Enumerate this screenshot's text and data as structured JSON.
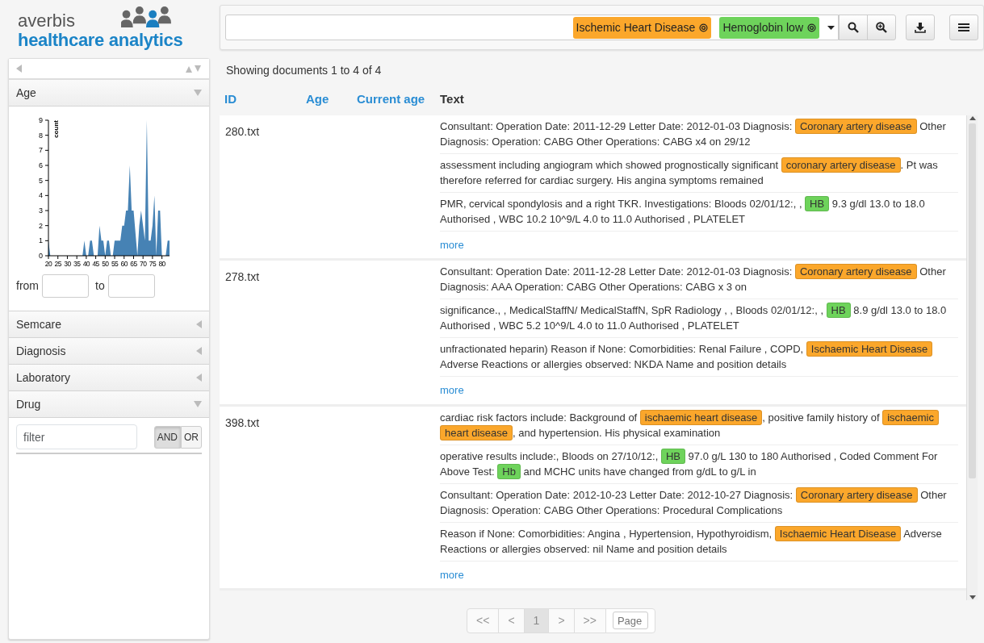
{
  "logo": {
    "line1": "averbis",
    "line2": "healthcare analytics"
  },
  "sidebar": {
    "facets": [
      {
        "title": "Age",
        "expanded": true,
        "kind": "histogram",
        "from_label": "from",
        "to_label": "to",
        "chart_data": {
          "type": "area",
          "ylabel": "count",
          "x": [
            20,
            21,
            22,
            38,
            39,
            40,
            41,
            42,
            43,
            44,
            46,
            47,
            48,
            49,
            50,
            51,
            52,
            53,
            54,
            55,
            56,
            57,
            58,
            59,
            60,
            61,
            62,
            63,
            64,
            65,
            67,
            68,
            69,
            70,
            71,
            72,
            73,
            74,
            75,
            76,
            77,
            78,
            79,
            80,
            81,
            82,
            83,
            84
          ],
          "values": [
            1,
            0,
            0,
            0,
            1,
            0,
            0,
            1,
            1,
            0,
            0,
            2,
            1,
            1,
            0,
            1,
            1,
            0,
            0,
            1,
            1,
            1,
            1,
            2,
            2,
            3,
            3,
            6,
            3,
            3,
            0,
            2,
            3,
            2,
            1,
            9,
            1,
            1,
            2,
            4,
            0,
            3,
            3,
            0,
            0,
            0,
            1,
            1
          ],
          "xlim": [
            20,
            84
          ],
          "ylim": [
            0,
            9
          ],
          "xticks": [
            20,
            25,
            30,
            35,
            40,
            45,
            50,
            55,
            60,
            65,
            70,
            75,
            80
          ],
          "yticks": [
            0,
            1,
            2,
            3,
            4,
            5,
            6,
            7,
            8,
            9
          ]
        }
      },
      {
        "title": "Semcare",
        "expanded": false
      },
      {
        "title": "Diagnosis",
        "expanded": false
      },
      {
        "title": "Laboratory",
        "expanded": false
      },
      {
        "title": "Drug",
        "expanded": true,
        "kind": "filter",
        "filter": {
          "placeholder": "filter"
        },
        "modes": [
          {
            "label": "AND",
            "selected": true
          },
          {
            "label": "OR",
            "selected": false
          }
        ]
      }
    ]
  },
  "search": {
    "tokens": [
      {
        "label": "Ischemic Heart Disease",
        "color": "#fba72b"
      },
      {
        "label": "Hemoglobin low",
        "color": "#6ed35b"
      }
    ]
  },
  "summary": "Showing documents 1 to 4 of 4",
  "columns": [
    {
      "label": "ID",
      "sortable": true
    },
    {
      "label": "Age",
      "sortable": true
    },
    {
      "label": "Current age",
      "sortable": true
    },
    {
      "label": "Text",
      "sortable": false
    }
  ],
  "documents": [
    {
      "id": "280.txt",
      "more": "more",
      "snippets": [
        [
          {
            "text": "Consultant: Operation Date: 2011-12-29 Letter Date: 2012-01-03 Diagnosis: "
          },
          {
            "text": "Coronary artery disease",
            "color": "#fba72b"
          },
          {
            "text": " Other Diagnosis: Operation: CABG Other Operations: CABG x4 on 29/12"
          }
        ],
        [
          {
            "text": "assessment including angiogram which showed prognostically significant "
          },
          {
            "text": "coronary artery disease",
            "color": "#fba72b"
          },
          {
            "text": ". Pt was therefore referred for cardiac surgery. His angina symptoms remained"
          }
        ],
        [
          {
            "text": "PMR, cervical spondylosis and a right TKR. Investigations: Bloods 02/01/12:, , "
          },
          {
            "text": "HB",
            "color": "#6ed35b"
          },
          {
            "text": " 9.3 g/dl 13.0 to 18.0 Authorised , WBC 10.2 10^9/L 4.0 to 11.0 Authorised , PLATELET"
          }
        ]
      ]
    },
    {
      "id": "278.txt",
      "more": "more",
      "snippets": [
        [
          {
            "text": "Consultant: Operation Date: 2011-12-28 Letter Date: 2012-01-03 Diagnosis: "
          },
          {
            "text": "Coronary artery disease",
            "color": "#fba72b"
          },
          {
            "text": " Other Diagnosis: AAA Operation: CABG Other Operations: CABG x 3 on"
          }
        ],
        [
          {
            "text": "significance., , MedicalStaffN/ MedicalStaffN, SpR Radiology , , Bloods 02/01/12:, , "
          },
          {
            "text": "HB",
            "color": "#6ed35b"
          },
          {
            "text": " 8.9 g/dl 13.0 to 18.0 Authorised , WBC 5.2 10^9/L 4.0 to 11.0 Authorised , PLATELET"
          }
        ],
        [
          {
            "text": "unfractionated heparin) Reason if None: Comorbidities: Renal Failure , COPD, "
          },
          {
            "text": "Ischaemic Heart Disease",
            "color": "#fba72b"
          },
          {
            "text": " Adverse Reactions or allergies observed: NKDA Name and position details"
          }
        ]
      ]
    },
    {
      "id": "398.txt",
      "more": "more",
      "snippets": [
        [
          {
            "text": "cardiac risk factors include: Background of "
          },
          {
            "text": "ischaemic heart disease",
            "color": "#fba72b"
          },
          {
            "text": ", positive family history of "
          },
          {
            "text": "ischaemic heart disease",
            "color": "#fba72b"
          },
          {
            "text": ", and hypertension. His physical examination"
          }
        ],
        [
          {
            "text": "operative results include:, Bloods on 27/10/12:, "
          },
          {
            "text": "HB",
            "color": "#6ed35b"
          },
          {
            "text": " 97.0 g/L 130 to 180 Authorised , Coded Comment For Above Test: "
          },
          {
            "text": "Hb",
            "color": "#6ed35b"
          },
          {
            "text": " and MCHC units have changed from g/dL to g/L in"
          }
        ],
        [
          {
            "text": "Consultant: Operation Date: 2012-10-23 Letter Date: 2012-10-27 Diagnosis: "
          },
          {
            "text": "Coronary artery disease",
            "color": "#fba72b"
          },
          {
            "text": " Other Diagnosis: Operation: CABG Other Operations: Procedural Complications"
          }
        ],
        [
          {
            "text": "Reason if None: Comorbidities: Angina , Hypertension, Hypothyroidism, "
          },
          {
            "text": "Ischaemic Heart Disease",
            "color": "#fba72b"
          },
          {
            "text": " Adverse Reactions or allergies observed: nil Name and position details"
          }
        ]
      ]
    }
  ],
  "pagination": {
    "pages": [
      {
        "label": "<<",
        "selected": false
      },
      {
        "label": "<",
        "selected": false
      },
      {
        "label": "1",
        "selected": true
      },
      {
        "label": ">",
        "selected": false
      },
      {
        "label": ">>",
        "selected": false
      }
    ],
    "page_input": {
      "placeholder": "Page"
    }
  }
}
